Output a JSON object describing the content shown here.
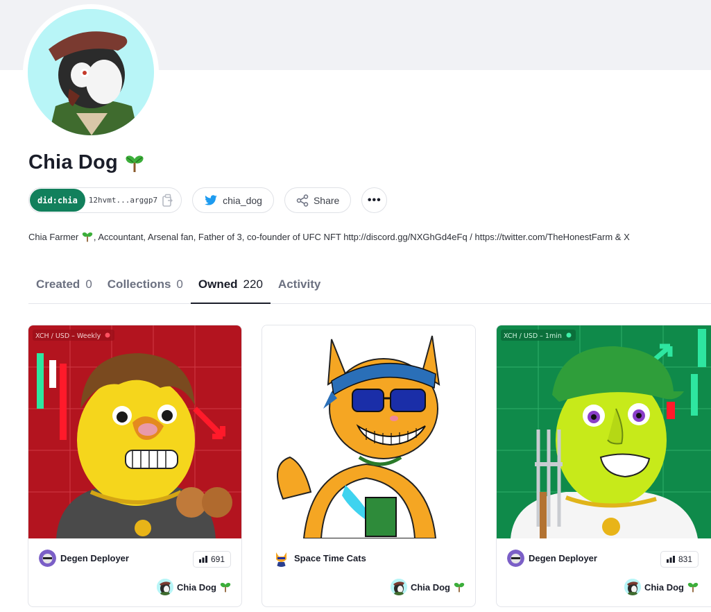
{
  "profile": {
    "name": "Chia Dog",
    "did_tag": "did:chia",
    "did_value": "12hvmt...arggp7",
    "twitter_handle": "chia_dog",
    "share_label": "Share",
    "more_label": "•••",
    "bio": "Chia Farmer",
    "bio_rest": ", Accountant, Arsenal fan, Father of 3, co-founder of UFC NFT http://discord.gg/NXGhGd4eFq / https://twitter.com/TheHonestFarm & X"
  },
  "tabs": [
    {
      "label": "Created",
      "count": "0"
    },
    {
      "label": "Collections",
      "count": "0"
    },
    {
      "label": "Owned",
      "count": "220"
    },
    {
      "label": "Activity",
      "count": ""
    }
  ],
  "cards": [
    {
      "collection": "Degen Deployer",
      "views": "691",
      "owner": "Chia Dog",
      "overlay": "XCH / USD – Weekly"
    },
    {
      "collection": "Space Time Cats",
      "views": "",
      "owner": "Chia Dog",
      "overlay": ""
    },
    {
      "collection": "Degen Deployer",
      "views": "831",
      "owner": "Chia Dog",
      "overlay": "XCH / USD – 1min"
    }
  ],
  "icons": {
    "copy": "copy-icon",
    "twitter": "twitter-icon",
    "share": "share-icon",
    "more": "more-icon",
    "views": "bar-chart-icon",
    "sprout": "sprout-icon"
  },
  "colors": {
    "accent": "#12805c",
    "twitter": "#1d9bf0",
    "banner": "#f1f2f5"
  }
}
